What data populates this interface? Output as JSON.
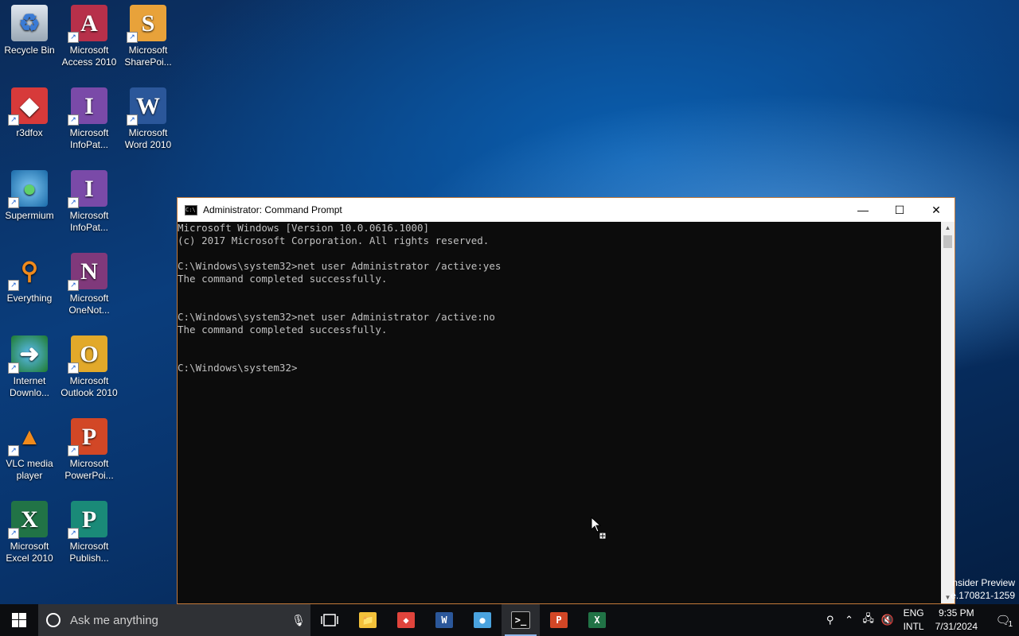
{
  "desktop": {
    "icons": [
      {
        "label1": "Recycle Bin",
        "label2": "",
        "icon": "recycle-bin-icon"
      },
      {
        "label1": "Microsoft",
        "label2": "Access 2010",
        "icon": "access-icon"
      },
      {
        "label1": "Microsoft",
        "label2": "SharePoi...",
        "icon": "sharepoint-icon"
      },
      {
        "label1": "r3dfox",
        "label2": "",
        "icon": "r3dfox-icon"
      },
      {
        "label1": "Microsoft",
        "label2": "InfoPat...",
        "icon": "infopath-icon"
      },
      {
        "label1": "Microsoft",
        "label2": "Word 2010",
        "icon": "word-icon"
      },
      {
        "label1": "Supermium",
        "label2": "",
        "icon": "supermium-icon"
      },
      {
        "label1": "Microsoft",
        "label2": "InfoPat...",
        "icon": "infopath-icon"
      },
      {
        "label1": "Everything",
        "label2": "",
        "icon": "everything-icon"
      },
      {
        "label1": "Microsoft",
        "label2": "OneNot...",
        "icon": "onenote-icon"
      },
      {
        "label1": "Internet",
        "label2": "Downlo...",
        "icon": "internet-download-manager-icon"
      },
      {
        "label1": "Microsoft",
        "label2": "Outlook 2010",
        "icon": "outlook-icon"
      },
      {
        "label1": "VLC media",
        "label2": "player",
        "icon": "vlc-icon"
      },
      {
        "label1": "Microsoft",
        "label2": "PowerPoi...",
        "icon": "powerpoint-icon"
      },
      {
        "label1": "Microsoft",
        "label2": "Excel 2010",
        "icon": "excel-icon"
      },
      {
        "label1": "Microsoft",
        "label2": "Publish...",
        "icon": "publisher-icon"
      }
    ],
    "watermark_line1": "nsider Preview",
    "watermark_line2": "e.170821-1259"
  },
  "cmd_window": {
    "title": "Administrator: Command Prompt",
    "minimize": "—",
    "maximize": "☐",
    "close": "✕",
    "lines": [
      "Microsoft Windows [Version 10.0.0616.1000]",
      "(c) 2017 Microsoft Corporation. All rights reserved.",
      "",
      "C:\\Windows\\system32>net user Administrator /active:yes",
      "The command completed successfully.",
      "",
      "",
      "C:\\Windows\\system32>net user Administrator /active:no",
      "The command completed successfully.",
      "",
      "",
      "C:\\Windows\\system32>"
    ]
  },
  "taskbar": {
    "search_placeholder": "Ask me anything",
    "apps": [
      {
        "name": "file-explorer",
        "glyph": "📁",
        "color": "#f3c13a",
        "running": false
      },
      {
        "name": "r3dfox",
        "glyph": "◆",
        "color": "#e0443c",
        "running": false
      },
      {
        "name": "word",
        "glyph": "W",
        "color": "#2b579a",
        "running": false
      },
      {
        "name": "supermium",
        "glyph": "●",
        "color": "#4aa3df",
        "running": false
      },
      {
        "name": "command-prompt",
        "glyph": ">_",
        "color": "#111111",
        "running": true
      },
      {
        "name": "powerpoint",
        "glyph": "P",
        "color": "#d24726",
        "running": false
      },
      {
        "name": "excel",
        "glyph": "X",
        "color": "#217346",
        "running": false
      }
    ],
    "tray": {
      "lang_top": "ENG",
      "lang_bottom": "INTL",
      "time": "9:35 PM",
      "date": "7/31/2024",
      "notification_count": "1"
    }
  }
}
